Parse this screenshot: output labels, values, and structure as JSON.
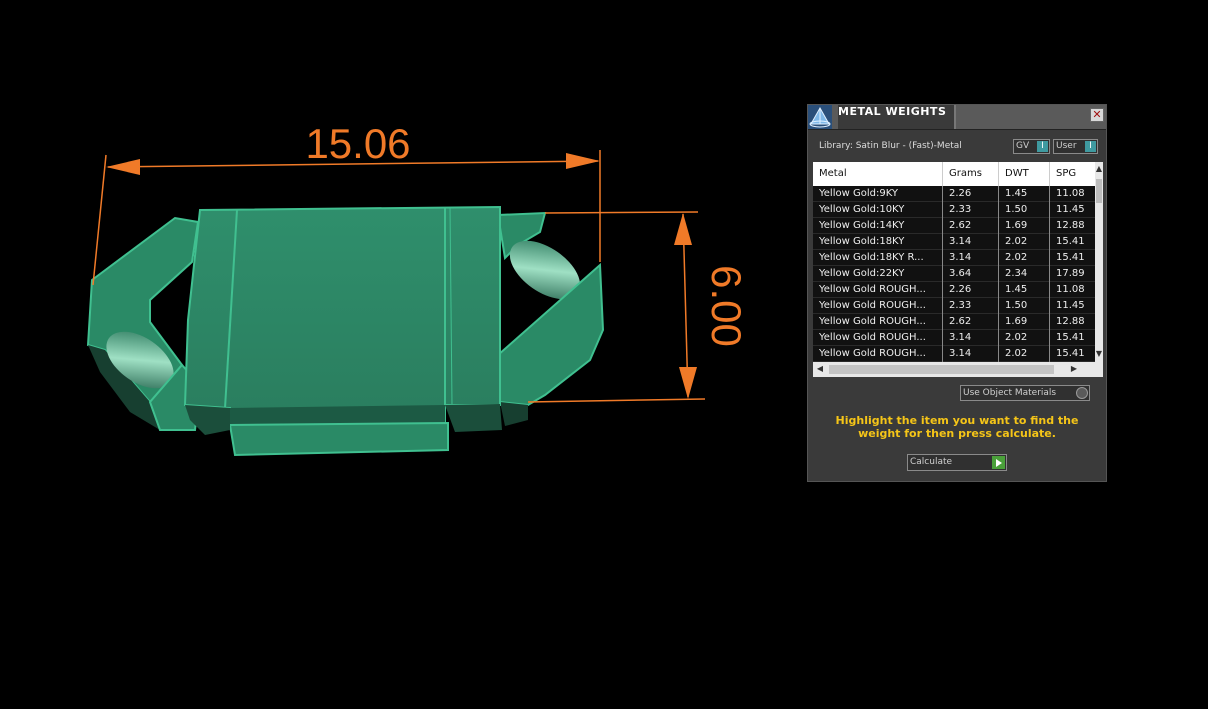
{
  "viewport": {
    "dimension_width": "15.06",
    "dimension_height": "6.00",
    "model_color": "#2e8a66",
    "dimension_color": "#f07a28"
  },
  "panel": {
    "title": "METAL WEIGHTS",
    "library_label": "Library: Satin Blur - (Fast)-Metal",
    "gv_label": "GV",
    "user_label": "User",
    "columns": [
      "Metal",
      "Grams",
      "DWT",
      "SPG"
    ],
    "rows": [
      {
        "metal": "Yellow Gold:9KY",
        "grams": "2.26",
        "dwt": "1.45",
        "spg": "11.08"
      },
      {
        "metal": "Yellow Gold:10KY",
        "grams": "2.33",
        "dwt": "1.50",
        "spg": "11.45"
      },
      {
        "metal": "Yellow Gold:14KY",
        "grams": "2.62",
        "dwt": "1.69",
        "spg": "12.88"
      },
      {
        "metal": "Yellow Gold:18KY",
        "grams": "3.14",
        "dwt": "2.02",
        "spg": "15.41"
      },
      {
        "metal": "Yellow Gold:18KY R...",
        "grams": "3.14",
        "dwt": "2.02",
        "spg": "15.41"
      },
      {
        "metal": "Yellow Gold:22KY",
        "grams": "3.64",
        "dwt": "2.34",
        "spg": "17.89"
      },
      {
        "metal": "Yellow Gold ROUGH...",
        "grams": "2.26",
        "dwt": "1.45",
        "spg": "11.08"
      },
      {
        "metal": "Yellow Gold ROUGH...",
        "grams": "2.33",
        "dwt": "1.50",
        "spg": "11.45"
      },
      {
        "metal": "Yellow Gold ROUGH...",
        "grams": "2.62",
        "dwt": "1.69",
        "spg": "12.88"
      },
      {
        "metal": "Yellow Gold ROUGH...",
        "grams": "3.14",
        "dwt": "2.02",
        "spg": "15.41"
      },
      {
        "metal": "Yellow Gold ROUGH...",
        "grams": "3.14",
        "dwt": "2.02",
        "spg": "15.41"
      }
    ],
    "use_object_materials": "Use Object Materials",
    "instructions": "Highlight the item you want to find the weight for then press calculate.",
    "calculate_label": "Calculate",
    "accent_color": "#f5c518"
  }
}
